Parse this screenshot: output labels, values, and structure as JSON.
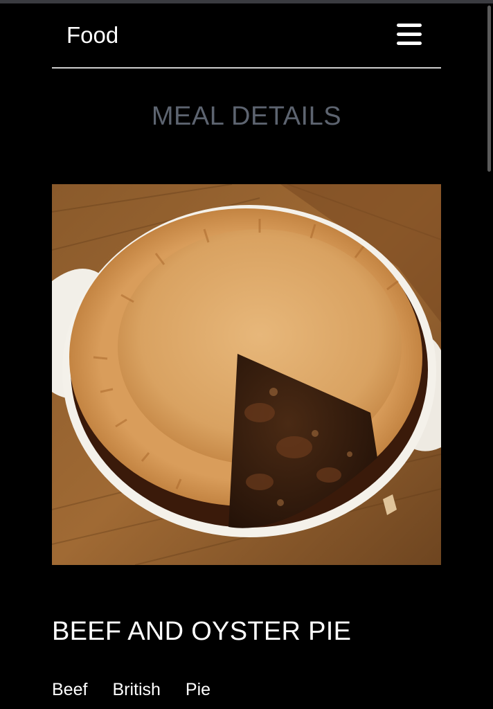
{
  "header": {
    "brand": "Food",
    "menu_icon": "hamburger-menu-icon"
  },
  "page": {
    "section_title": "MEAL DETAILS"
  },
  "meal": {
    "image_alt": "Beef and oyster pie in a white dish with a slice cut out",
    "name": "BEEF AND OYSTER PIE",
    "tags": [
      "Beef",
      "British",
      "Pie"
    ]
  },
  "colors": {
    "background": "#000000",
    "text": "#ffffff",
    "section_title": "#5d6470",
    "divider": "#cfcfcf"
  }
}
